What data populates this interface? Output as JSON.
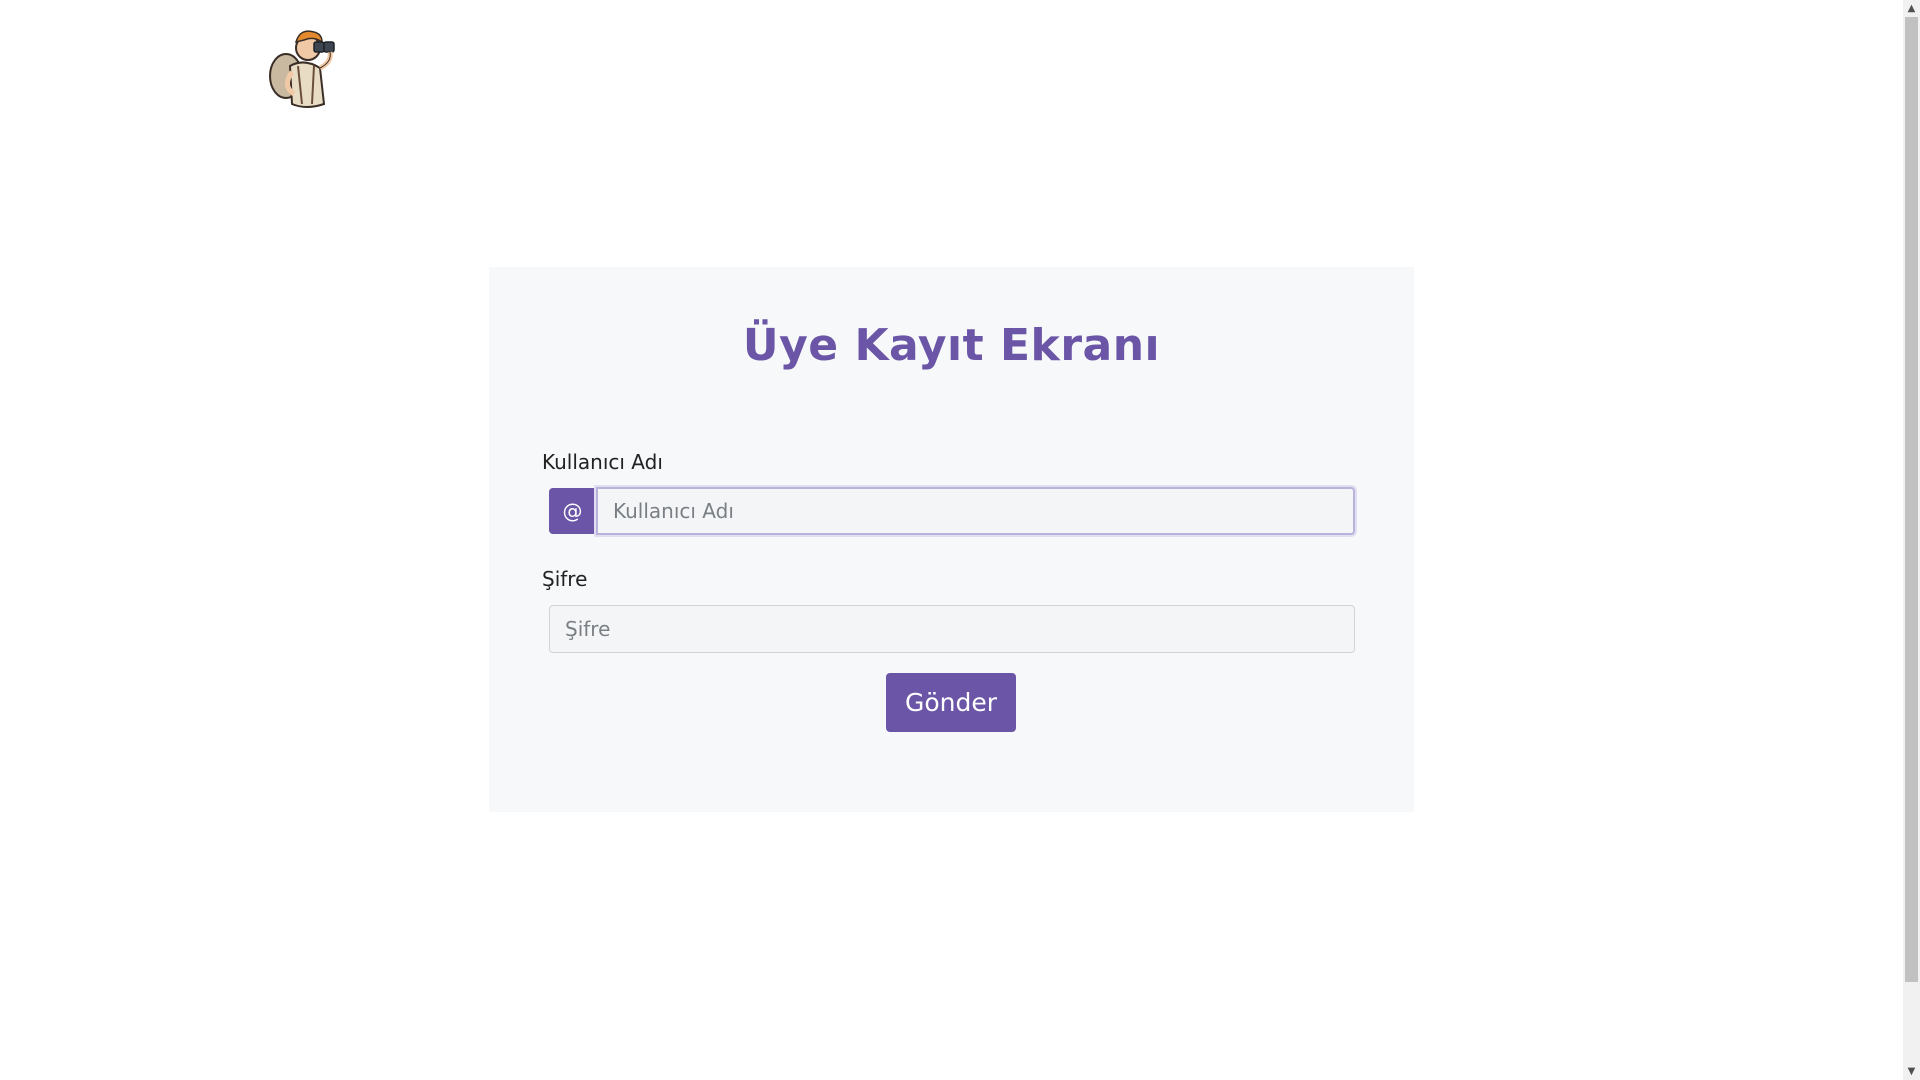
{
  "header": {
    "logo_icon": "explorer-binoculars-logo-icon"
  },
  "form": {
    "title": "Üye Kayıt Ekranı",
    "username": {
      "label": "Kullanıcı Adı",
      "addon": "@",
      "placeholder": "Kullanıcı Adı",
      "value": ""
    },
    "password": {
      "label": "Şifre",
      "placeholder": "Şifre",
      "value": ""
    },
    "submit_label": "Gönder"
  },
  "scrollbar": {
    "up_arrow": "▲",
    "down_arrow": "▼"
  },
  "colors": {
    "accent": "#6a55a6",
    "card_background": "#f7f8f9",
    "input_background": "#f4f5f6"
  }
}
